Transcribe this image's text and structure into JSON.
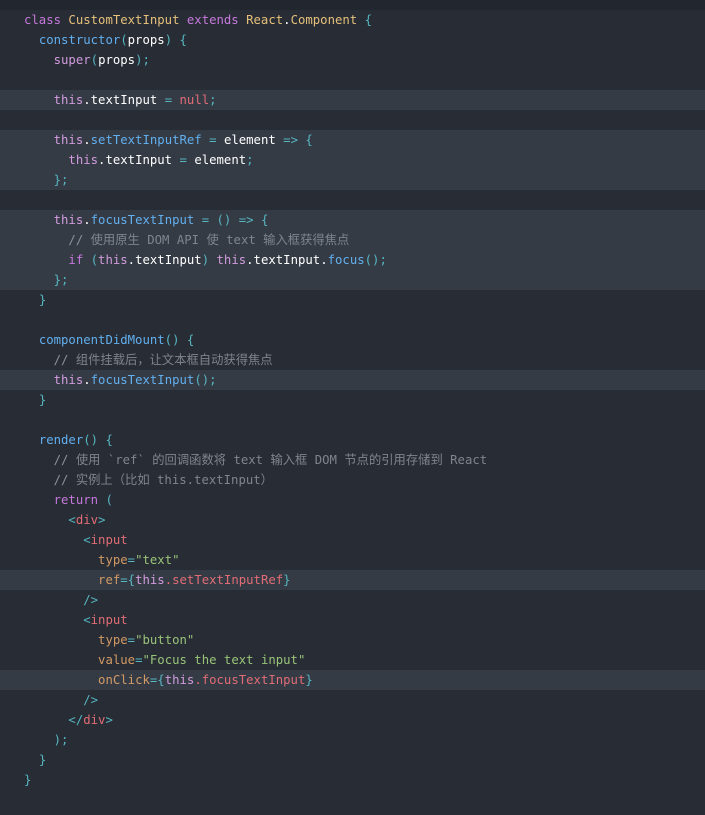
{
  "editor": {
    "language": "jsx",
    "theme": "one-dark",
    "background_color": "#282c34",
    "highlight_color": "#353b45",
    "top_strip_color": "#22262e",
    "title": "CustomTextInput React component source"
  },
  "code": {
    "lines": [
      {
        "n": 1,
        "highlighted": false,
        "text": "class CustomTextInput extends React.Component {",
        "tokens": [
          {
            "t": "class ",
            "c": "tok-key"
          },
          {
            "t": "CustomTextInput",
            "c": "tok-class"
          },
          {
            "t": " ",
            "c": "tok-plain"
          },
          {
            "t": "extends",
            "c": "tok-key"
          },
          {
            "t": " ",
            "c": "tok-plain"
          },
          {
            "t": "React",
            "c": "tok-class"
          },
          {
            "t": ".",
            "c": "tok-plain"
          },
          {
            "t": "Component",
            "c": "tok-class"
          },
          {
            "t": " ",
            "c": "tok-plain"
          },
          {
            "t": "{",
            "c": "tok-punc"
          }
        ]
      },
      {
        "n": 2,
        "highlighted": false,
        "text": "  constructor(props) {",
        "tokens": [
          {
            "t": "  ",
            "c": "tok-plain"
          },
          {
            "t": "constructor",
            "c": "tok-fn"
          },
          {
            "t": "(",
            "c": "tok-punc"
          },
          {
            "t": "props",
            "c": "tok-plain"
          },
          {
            "t": ")",
            "c": "tok-punc"
          },
          {
            "t": " ",
            "c": "tok-plain"
          },
          {
            "t": "{",
            "c": "tok-punc"
          }
        ]
      },
      {
        "n": 3,
        "highlighted": false,
        "text": "    super(props);",
        "tokens": [
          {
            "t": "    ",
            "c": "tok-plain"
          },
          {
            "t": "super",
            "c": "tok-this"
          },
          {
            "t": "(",
            "c": "tok-punc"
          },
          {
            "t": "props",
            "c": "tok-plain"
          },
          {
            "t": ")",
            "c": "tok-punc"
          },
          {
            "t": ";",
            "c": "tok-punc"
          }
        ]
      },
      {
        "n": 4,
        "highlighted": false,
        "text": "",
        "tokens": []
      },
      {
        "n": 5,
        "highlighted": true,
        "text": "    this.textInput = null;",
        "tokens": [
          {
            "t": "    ",
            "c": "tok-plain"
          },
          {
            "t": "this",
            "c": "tok-this"
          },
          {
            "t": ".textInput",
            "c": "tok-plain"
          },
          {
            "t": " ",
            "c": "tok-plain"
          },
          {
            "t": "=",
            "c": "tok-op"
          },
          {
            "t": " ",
            "c": "tok-plain"
          },
          {
            "t": "null",
            "c": "tok-const"
          },
          {
            "t": ";",
            "c": "tok-punc"
          }
        ]
      },
      {
        "n": 6,
        "highlighted": false,
        "text": "",
        "tokens": []
      },
      {
        "n": 7,
        "highlighted": true,
        "text": "    this.setTextInputRef = element => {",
        "tokens": [
          {
            "t": "    ",
            "c": "tok-plain"
          },
          {
            "t": "this",
            "c": "tok-this"
          },
          {
            "t": ".",
            "c": "tok-plain"
          },
          {
            "t": "setTextInputRef",
            "c": "tok-fn"
          },
          {
            "t": " ",
            "c": "tok-plain"
          },
          {
            "t": "=",
            "c": "tok-op"
          },
          {
            "t": " ",
            "c": "tok-plain"
          },
          {
            "t": "element",
            "c": "tok-plain"
          },
          {
            "t": " ",
            "c": "tok-plain"
          },
          {
            "t": "=>",
            "c": "tok-op"
          },
          {
            "t": " ",
            "c": "tok-plain"
          },
          {
            "t": "{",
            "c": "tok-punc"
          }
        ]
      },
      {
        "n": 8,
        "highlighted": true,
        "text": "      this.textInput = element;",
        "tokens": [
          {
            "t": "      ",
            "c": "tok-plain"
          },
          {
            "t": "this",
            "c": "tok-this"
          },
          {
            "t": ".textInput",
            "c": "tok-plain"
          },
          {
            "t": " ",
            "c": "tok-plain"
          },
          {
            "t": "=",
            "c": "tok-op"
          },
          {
            "t": " ",
            "c": "tok-plain"
          },
          {
            "t": "element",
            "c": "tok-plain"
          },
          {
            "t": ";",
            "c": "tok-punc"
          }
        ]
      },
      {
        "n": 9,
        "highlighted": true,
        "text": "    };",
        "tokens": [
          {
            "t": "    ",
            "c": "tok-plain"
          },
          {
            "t": "};",
            "c": "tok-punc"
          }
        ]
      },
      {
        "n": 10,
        "highlighted": false,
        "text": "",
        "tokens": []
      },
      {
        "n": 11,
        "highlighted": true,
        "text": "    this.focusTextInput = () => {",
        "tokens": [
          {
            "t": "    ",
            "c": "tok-plain"
          },
          {
            "t": "this",
            "c": "tok-this"
          },
          {
            "t": ".",
            "c": "tok-plain"
          },
          {
            "t": "focusTextInput",
            "c": "tok-fn"
          },
          {
            "t": " ",
            "c": "tok-plain"
          },
          {
            "t": "=",
            "c": "tok-op"
          },
          {
            "t": " ",
            "c": "tok-plain"
          },
          {
            "t": "()",
            "c": "tok-punc"
          },
          {
            "t": " ",
            "c": "tok-plain"
          },
          {
            "t": "=>",
            "c": "tok-op"
          },
          {
            "t": " ",
            "c": "tok-plain"
          },
          {
            "t": "{",
            "c": "tok-punc"
          }
        ]
      },
      {
        "n": 12,
        "highlighted": true,
        "text": "      // 使用原生 DOM API 使 text 输入框获得焦点",
        "tokens": [
          {
            "t": "      ",
            "c": "tok-plain"
          },
          {
            "t": "//",
            "c": "tok-comment-slash"
          },
          {
            "t": " 使用原生 DOM API 使 text 输入框获得焦点",
            "c": "tok-comment"
          }
        ]
      },
      {
        "n": 13,
        "highlighted": true,
        "text": "      if (this.textInput) this.textInput.focus();",
        "tokens": [
          {
            "t": "      ",
            "c": "tok-plain"
          },
          {
            "t": "if",
            "c": "tok-key"
          },
          {
            "t": " ",
            "c": "tok-plain"
          },
          {
            "t": "(",
            "c": "tok-punc"
          },
          {
            "t": "this",
            "c": "tok-this"
          },
          {
            "t": ".textInput",
            "c": "tok-plain"
          },
          {
            "t": ")",
            "c": "tok-punc"
          },
          {
            "t": " ",
            "c": "tok-plain"
          },
          {
            "t": "this",
            "c": "tok-this"
          },
          {
            "t": ".textInput",
            "c": "tok-plain"
          },
          {
            "t": ".",
            "c": "tok-plain"
          },
          {
            "t": "focus",
            "c": "tok-fn"
          },
          {
            "t": "()",
            "c": "tok-punc"
          },
          {
            "t": ";",
            "c": "tok-punc"
          }
        ]
      },
      {
        "n": 14,
        "highlighted": true,
        "text": "    };",
        "tokens": [
          {
            "t": "    ",
            "c": "tok-plain"
          },
          {
            "t": "};",
            "c": "tok-punc"
          }
        ]
      },
      {
        "n": 15,
        "highlighted": false,
        "text": "  }",
        "tokens": [
          {
            "t": "  ",
            "c": "tok-plain"
          },
          {
            "t": "}",
            "c": "tok-punc"
          }
        ]
      },
      {
        "n": 16,
        "highlighted": false,
        "text": "",
        "tokens": []
      },
      {
        "n": 17,
        "highlighted": false,
        "text": "  componentDidMount() {",
        "tokens": [
          {
            "t": "  ",
            "c": "tok-plain"
          },
          {
            "t": "componentDidMount",
            "c": "tok-fn"
          },
          {
            "t": "()",
            "c": "tok-punc"
          },
          {
            "t": " ",
            "c": "tok-plain"
          },
          {
            "t": "{",
            "c": "tok-punc"
          }
        ]
      },
      {
        "n": 18,
        "highlighted": false,
        "text": "    // 组件挂载后，让文本框自动获得焦点",
        "tokens": [
          {
            "t": "    ",
            "c": "tok-plain"
          },
          {
            "t": "//",
            "c": "tok-comment-slash"
          },
          {
            "t": " 组件挂载后，让文本框自动获得焦点",
            "c": "tok-comment"
          }
        ]
      },
      {
        "n": 19,
        "highlighted": true,
        "text": "    this.focusTextInput();",
        "tokens": [
          {
            "t": "    ",
            "c": "tok-plain"
          },
          {
            "t": "this",
            "c": "tok-this"
          },
          {
            "t": ".",
            "c": "tok-plain"
          },
          {
            "t": "focusTextInput",
            "c": "tok-fn"
          },
          {
            "t": "()",
            "c": "tok-punc"
          },
          {
            "t": ";",
            "c": "tok-punc"
          }
        ]
      },
      {
        "n": 20,
        "highlighted": false,
        "text": "  }",
        "tokens": [
          {
            "t": "  ",
            "c": "tok-plain"
          },
          {
            "t": "}",
            "c": "tok-punc"
          }
        ]
      },
      {
        "n": 21,
        "highlighted": false,
        "text": "",
        "tokens": []
      },
      {
        "n": 22,
        "highlighted": false,
        "text": "  render() {",
        "tokens": [
          {
            "t": "  ",
            "c": "tok-plain"
          },
          {
            "t": "render",
            "c": "tok-fn"
          },
          {
            "t": "()",
            "c": "tok-punc"
          },
          {
            "t": " ",
            "c": "tok-plain"
          },
          {
            "t": "{",
            "c": "tok-punc"
          }
        ]
      },
      {
        "n": 23,
        "highlighted": false,
        "text": "    // 使用 `ref` 的回调函数将 text 输入框 DOM 节点的引用存储到 React",
        "tokens": [
          {
            "t": "    ",
            "c": "tok-plain"
          },
          {
            "t": "//",
            "c": "tok-comment-slash"
          },
          {
            "t": " 使用 `ref` 的回调函数将 text 输入框 DOM 节点的引用存储到 React",
            "c": "tok-comment"
          }
        ]
      },
      {
        "n": 24,
        "highlighted": false,
        "text": "    // 实例上（比如 this.textInput）",
        "tokens": [
          {
            "t": "    ",
            "c": "tok-plain"
          },
          {
            "t": "//",
            "c": "tok-comment-slash"
          },
          {
            "t": " 实例上（比如 this.textInput）",
            "c": "tok-comment"
          }
        ]
      },
      {
        "n": 25,
        "highlighted": false,
        "text": "    return (",
        "tokens": [
          {
            "t": "    ",
            "c": "tok-plain"
          },
          {
            "t": "return",
            "c": "tok-key"
          },
          {
            "t": " ",
            "c": "tok-plain"
          },
          {
            "t": "(",
            "c": "tok-punc"
          }
        ]
      },
      {
        "n": 26,
        "highlighted": false,
        "text": "      <div>",
        "tokens": [
          {
            "t": "      ",
            "c": "tok-plain"
          },
          {
            "t": "<",
            "c": "tok-punc"
          },
          {
            "t": "div",
            "c": "tok-tag"
          },
          {
            "t": ">",
            "c": "tok-punc"
          }
        ]
      },
      {
        "n": 27,
        "highlighted": false,
        "text": "        <input",
        "tokens": [
          {
            "t": "        ",
            "c": "tok-plain"
          },
          {
            "t": "<",
            "c": "tok-punc"
          },
          {
            "t": "input",
            "c": "tok-tag"
          }
        ]
      },
      {
        "n": 28,
        "highlighted": false,
        "text": "          type=\"text\"",
        "tokens": [
          {
            "t": "          ",
            "c": "tok-plain"
          },
          {
            "t": "type",
            "c": "tok-attr"
          },
          {
            "t": "=",
            "c": "tok-punc"
          },
          {
            "t": "\"text\"",
            "c": "tok-str"
          }
        ]
      },
      {
        "n": 29,
        "highlighted": true,
        "text": "          ref={this.setTextInputRef}",
        "tokens": [
          {
            "t": "          ",
            "c": "tok-plain"
          },
          {
            "t": "ref",
            "c": "tok-attr"
          },
          {
            "t": "=",
            "c": "tok-punc"
          },
          {
            "t": "{",
            "c": "tok-punc"
          },
          {
            "t": "this",
            "c": "tok-this"
          },
          {
            "t": ".setTextInputRef",
            "c": "tok-const"
          },
          {
            "t": "}",
            "c": "tok-punc"
          }
        ]
      },
      {
        "n": 30,
        "highlighted": false,
        "text": "        />",
        "tokens": [
          {
            "t": "        ",
            "c": "tok-plain"
          },
          {
            "t": "/>",
            "c": "tok-punc"
          }
        ]
      },
      {
        "n": 31,
        "highlighted": false,
        "text": "        <input",
        "tokens": [
          {
            "t": "        ",
            "c": "tok-plain"
          },
          {
            "t": "<",
            "c": "tok-punc"
          },
          {
            "t": "input",
            "c": "tok-tag"
          }
        ]
      },
      {
        "n": 32,
        "highlighted": false,
        "text": "          type=\"button\"",
        "tokens": [
          {
            "t": "          ",
            "c": "tok-plain"
          },
          {
            "t": "type",
            "c": "tok-attr"
          },
          {
            "t": "=",
            "c": "tok-punc"
          },
          {
            "t": "\"button\"",
            "c": "tok-str"
          }
        ]
      },
      {
        "n": 33,
        "highlighted": false,
        "text": "          value=\"Focus the text input\"",
        "tokens": [
          {
            "t": "          ",
            "c": "tok-plain"
          },
          {
            "t": "value",
            "c": "tok-attr"
          },
          {
            "t": "=",
            "c": "tok-punc"
          },
          {
            "t": "\"Focus the text input\"",
            "c": "tok-str"
          }
        ]
      },
      {
        "n": 34,
        "highlighted": true,
        "text": "          onClick={this.focusTextInput}",
        "tokens": [
          {
            "t": "          ",
            "c": "tok-plain"
          },
          {
            "t": "onClick",
            "c": "tok-attr"
          },
          {
            "t": "=",
            "c": "tok-punc"
          },
          {
            "t": "{",
            "c": "tok-punc"
          },
          {
            "t": "this",
            "c": "tok-this"
          },
          {
            "t": ".focusTextInput",
            "c": "tok-const"
          },
          {
            "t": "}",
            "c": "tok-punc"
          }
        ]
      },
      {
        "n": 35,
        "highlighted": false,
        "text": "        />",
        "tokens": [
          {
            "t": "        ",
            "c": "tok-plain"
          },
          {
            "t": "/>",
            "c": "tok-punc"
          }
        ]
      },
      {
        "n": 36,
        "highlighted": false,
        "text": "      </div>",
        "tokens": [
          {
            "t": "      ",
            "c": "tok-plain"
          },
          {
            "t": "</",
            "c": "tok-punc"
          },
          {
            "t": "div",
            "c": "tok-tag"
          },
          {
            "t": ">",
            "c": "tok-punc"
          }
        ]
      },
      {
        "n": 37,
        "highlighted": false,
        "text": "    );",
        "tokens": [
          {
            "t": "    ",
            "c": "tok-plain"
          },
          {
            "t": ");",
            "c": "tok-punc"
          }
        ]
      },
      {
        "n": 38,
        "highlighted": false,
        "text": "  }",
        "tokens": [
          {
            "t": "  ",
            "c": "tok-plain"
          },
          {
            "t": "}",
            "c": "tok-punc"
          }
        ]
      },
      {
        "n": 39,
        "highlighted": false,
        "text": "}",
        "tokens": [
          {
            "t": "}",
            "c": "tok-punc"
          }
        ]
      }
    ]
  }
}
